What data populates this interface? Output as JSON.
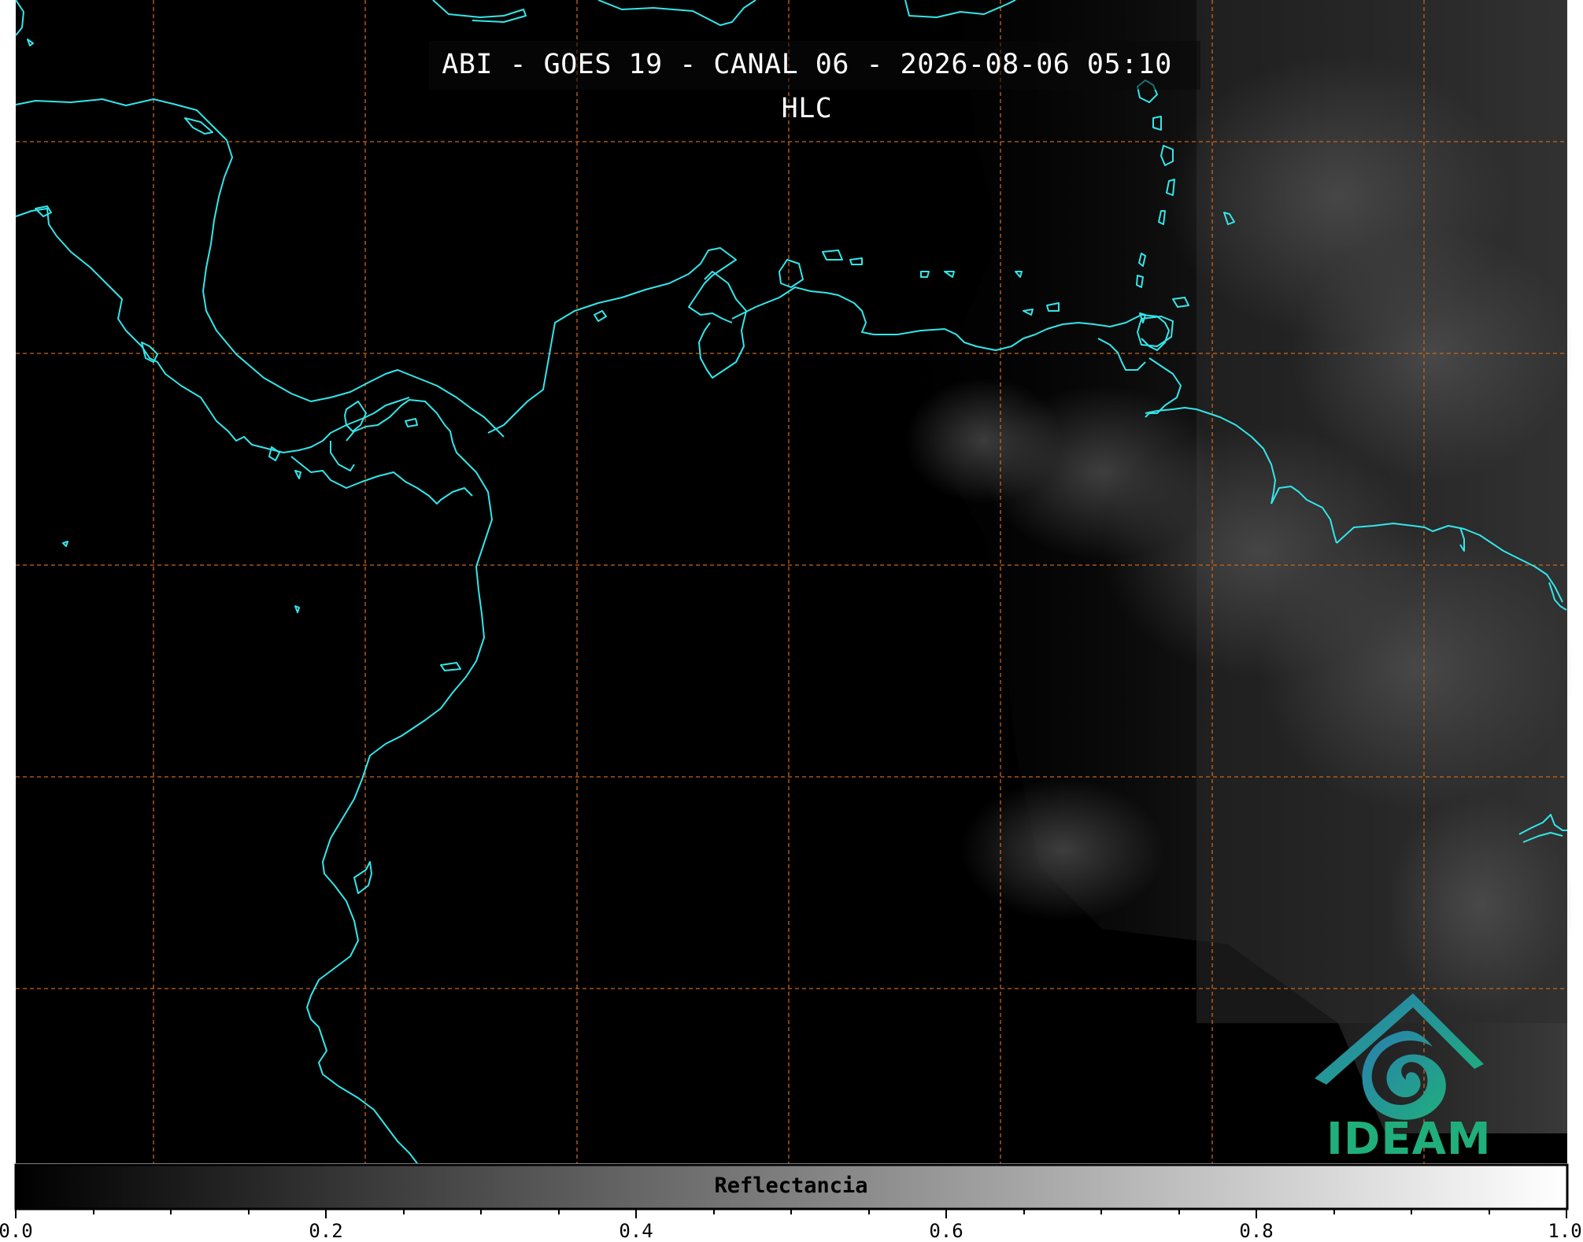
{
  "title": "ABI - GOES 19 - CANAL 06 - 2026-08-06 05:10 HLC",
  "colorbar": {
    "label": "Reflectancia",
    "ticks": [
      "0.0",
      "0.2",
      "0.4",
      "0.6",
      "0.8",
      "1.0"
    ],
    "range": [
      0.0,
      1.0
    ],
    "colormap": "grayscale"
  },
  "logo": {
    "text": "IDEAM"
  },
  "colors": {
    "background": "#000000",
    "coastline": "#33e6ea",
    "gridlines": "#c8661a",
    "logo_green": "#1fae7c",
    "logo_blue": "#2a7fb0"
  },
  "map_layers": [
    "coastlines",
    "lat-lon-gridlines"
  ]
}
